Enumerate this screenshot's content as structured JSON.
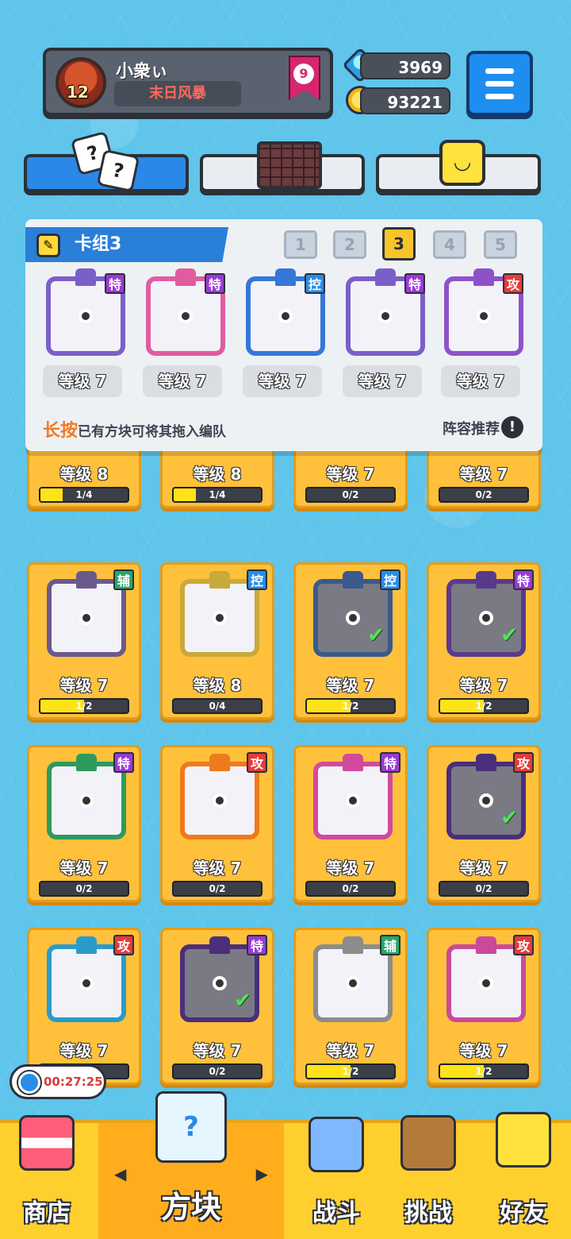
{
  "header": {
    "player_name": "小衆ぃ",
    "player_title": "末日风暴",
    "player_level": "12",
    "rank_badge": "9"
  },
  "currency": {
    "gems": "3969",
    "gold": "93221"
  },
  "category_tabs": [
    {
      "name": "dice",
      "active": true
    },
    {
      "name": "board",
      "active": false
    },
    {
      "name": "emoji",
      "active": false
    }
  ],
  "deck": {
    "title": "卡组3",
    "tabs": [
      "1",
      "2",
      "3",
      "4",
      "5"
    ],
    "active_tab": "3",
    "cards": [
      {
        "type": "特",
        "level": "等级 7",
        "color": "#7b5fc9"
      },
      {
        "type": "特",
        "level": "等级 7",
        "color": "#e05ca0"
      },
      {
        "type": "控",
        "level": "等级 7",
        "color": "#3577d8"
      },
      {
        "type": "特",
        "level": "等级 7",
        "color": "#7b5fc9"
      },
      {
        "type": "攻",
        "level": "等级 7",
        "color": "#8d52c9"
      }
    ],
    "hint_highlight": "长按",
    "hint_text": "已有方块可将其拖入编队",
    "recommend": "阵容推荐",
    "recommend_icon": "!"
  },
  "collection": [
    {
      "type": "",
      "level": "等级 8",
      "progress": "1/4",
      "pct": 25,
      "color": "#d24a4a",
      "check": false,
      "dim": false
    },
    {
      "type": "",
      "level": "等级 8",
      "progress": "1/4",
      "pct": 25,
      "color": "#8d6bd6",
      "check": false,
      "dim": false
    },
    {
      "type": "",
      "level": "等级 7",
      "progress": "0/2",
      "pct": 0,
      "color": "#d28a30",
      "check": false,
      "dim": false
    },
    {
      "type": "",
      "level": "等级 7",
      "progress": "0/2",
      "pct": 0,
      "color": "#5a5a5a",
      "check": true,
      "dim": true
    },
    {
      "type": "辅",
      "level": "等级 7",
      "progress": "1/2",
      "pct": 50,
      "color": "#6a5a8c",
      "check": false,
      "dim": false
    },
    {
      "type": "控",
      "level": "等级 8",
      "progress": "0/4",
      "pct": 0,
      "color": "#c9a93a",
      "check": false,
      "dim": false
    },
    {
      "type": "控",
      "level": "等级 7",
      "progress": "1/2",
      "pct": 50,
      "color": "#3a5a8c",
      "check": true,
      "dim": true
    },
    {
      "type": "特",
      "level": "等级 7",
      "progress": "1/2",
      "pct": 50,
      "color": "#5a3a8c",
      "check": true,
      "dim": true
    },
    {
      "type": "特",
      "level": "等级 7",
      "progress": "0/2",
      "pct": 0,
      "color": "#2e9a5c",
      "check": false,
      "dim": false
    },
    {
      "type": "攻",
      "level": "等级 7",
      "progress": "0/2",
      "pct": 0,
      "color": "#ee7a1d",
      "check": false,
      "dim": false
    },
    {
      "type": "特",
      "level": "等级 7",
      "progress": "0/2",
      "pct": 0,
      "color": "#d24a9c",
      "check": false,
      "dim": false
    },
    {
      "type": "攻",
      "level": "等级 7",
      "progress": "0/2",
      "pct": 0,
      "color": "#4a2f7a",
      "check": true,
      "dim": true
    },
    {
      "type": "攻",
      "level": "等级 7",
      "progress": "0/2",
      "pct": 0,
      "color": "#2a9bc9",
      "check": false,
      "dim": false
    },
    {
      "type": "特",
      "level": "等级 7",
      "progress": "0/2",
      "pct": 0,
      "color": "#4a2f7a",
      "check": true,
      "dim": true
    },
    {
      "type": "辅",
      "level": "等级 7",
      "progress": "1/2",
      "pct": 50,
      "color": "#8c8c8c",
      "check": false,
      "dim": false
    },
    {
      "type": "攻",
      "level": "等级 7",
      "progress": "1/2",
      "pct": 50,
      "color": "#c94a9a",
      "check": false,
      "dim": false
    }
  ],
  "timer": "00:27:25",
  "bottom_nav": [
    {
      "label": "商店",
      "active": false
    },
    {
      "label": "方块",
      "active": true
    },
    {
      "label": "战斗",
      "active": false
    },
    {
      "label": "挑战",
      "active": false
    },
    {
      "label": "好友",
      "active": false
    }
  ],
  "colors": {
    "background": "#5fc5ea",
    "card_bg": "#ffc13b",
    "active_blue": "#2a89e6",
    "nav_bg": "#ffcf2e",
    "badge_special": "#9b39d8",
    "badge_control": "#2a8ce6",
    "badge_support": "#26a869",
    "badge_attack": "#e63a3a"
  }
}
